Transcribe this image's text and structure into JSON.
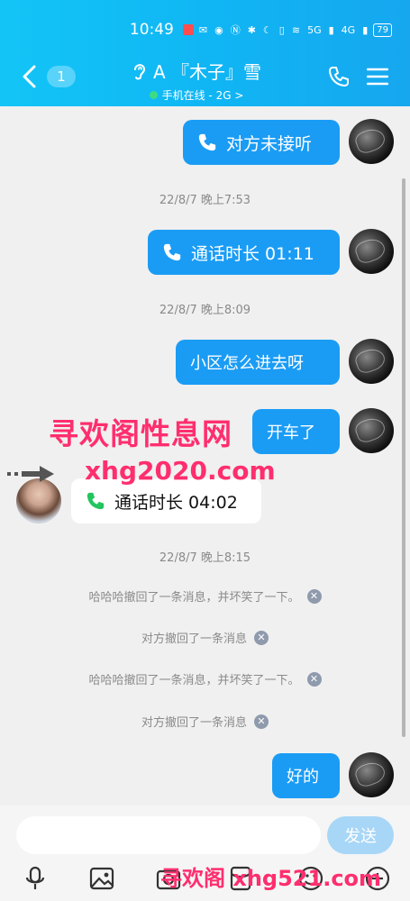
{
  "status_bar": {
    "time": "10:49",
    "net_label": "5G",
    "net_label2": "4G",
    "battery": "79"
  },
  "header": {
    "unread_count": "1",
    "title": "A 『木子』雪",
    "online_status": "手机在线 - 2G >"
  },
  "messages": [
    {
      "type": "out",
      "icon": "phone-icon",
      "text": "对方未接听"
    },
    {
      "type": "time",
      "text": "22/8/7 晚上7:53"
    },
    {
      "type": "out",
      "icon": "phone-icon",
      "text": "通话时长 01:11"
    },
    {
      "type": "time",
      "text": "22/8/7 晚上8:09"
    },
    {
      "type": "out",
      "text": "小区怎么进去呀"
    },
    {
      "type": "out",
      "text": "开车了"
    },
    {
      "type": "in",
      "icon": "phone-icon",
      "text": "通话时长 04:02"
    },
    {
      "type": "time",
      "text": "22/8/7 晚上8:15"
    },
    {
      "type": "system",
      "text": "哈哈哈撤回了一条消息，并坏笑了一下。"
    },
    {
      "type": "system",
      "text": "对方撤回了一条消息"
    },
    {
      "type": "system",
      "text": "哈哈哈撤回了一条消息，并坏笑了一下。"
    },
    {
      "type": "system",
      "text": "对方撤回了一条消息"
    },
    {
      "type": "out",
      "text": "好的"
    }
  ],
  "watermarks": {
    "cn": "寻欢阁性息网",
    "url": "xhg2020.com",
    "bottom": "寻欢阁 xhg521.com"
  },
  "input_bar": {
    "placeholder": "",
    "send_label": "发送"
  },
  "colors": {
    "header": "#13c5f7",
    "bubble_out": "#1a9cf5",
    "bubble_in": "#ffffff",
    "call_green": "#22c55e",
    "watermark": "#ff2e6e"
  }
}
